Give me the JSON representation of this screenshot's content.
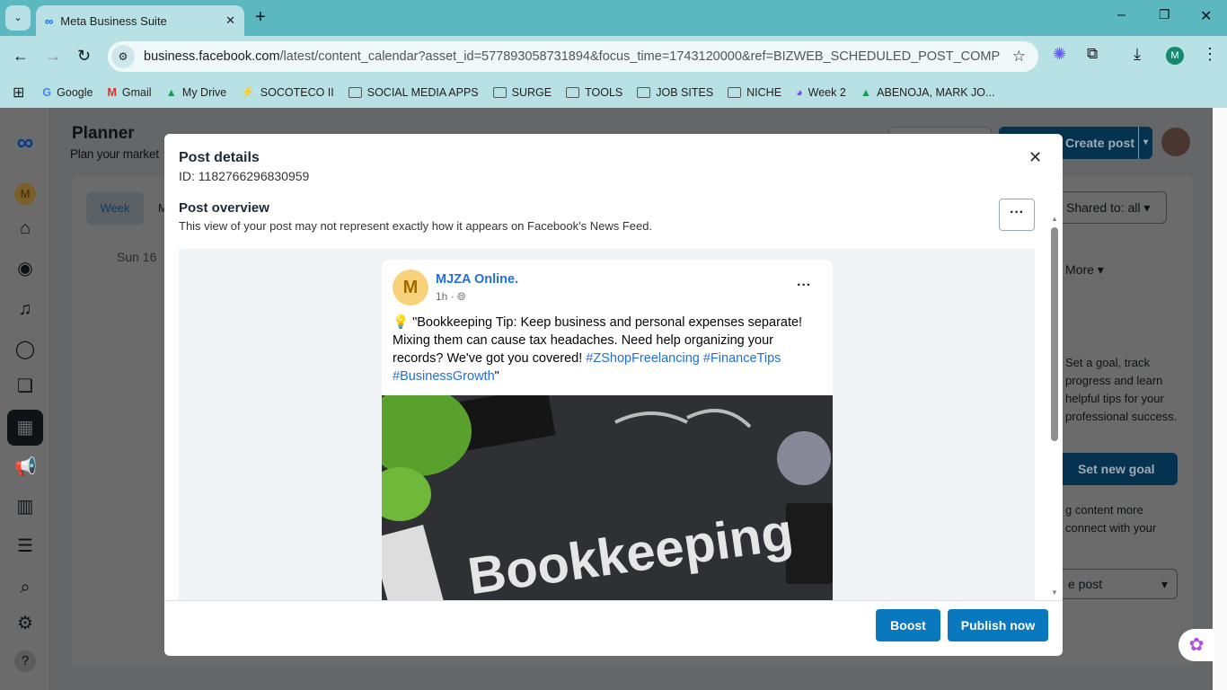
{
  "browser": {
    "tab_title": "Meta Business Suite",
    "url_host": "business.facebook.com",
    "url_path": "/latest/content_calendar?asset_id=577893058731894&focus_time=1743120000&ref=BIZWEB_SCHEDULED_POST_COMPOSER&na...",
    "profile_initial": "M",
    "bookmarks": [
      {
        "label": "Google",
        "icon": "google-icon"
      },
      {
        "label": "Gmail",
        "icon": "gmail-icon"
      },
      {
        "label": "My Drive",
        "icon": "drive-icon"
      },
      {
        "label": "SOCOTECO II",
        "icon": "socoteco-icon"
      },
      {
        "label": "SOCIAL MEDIA APPS",
        "icon": "folder-icon"
      },
      {
        "label": "SURGE",
        "icon": "folder-icon"
      },
      {
        "label": "TOOLS",
        "icon": "folder-icon"
      },
      {
        "label": "JOB SITES",
        "icon": "folder-icon"
      },
      {
        "label": "NICHE",
        "icon": "folder-icon"
      },
      {
        "label": "Week 2",
        "icon": "week-icon"
      },
      {
        "label": "ABENOJA, MARK JO...",
        "icon": "drive-icon"
      }
    ]
  },
  "planner": {
    "title": "Planner",
    "subtitle": "Plan your market",
    "view_week": "Week",
    "view_month": "M",
    "day": "Sun 16",
    "create_post": "Create post",
    "shared_to": "Shared to: all",
    "more": "More",
    "goal_text": "Set a goal, track progress and learn helpful tips for your professional success.",
    "goal_button": "Set new goal",
    "content_text": "g content more",
    "content_text2": "connect with your",
    "create_post_small": "e post"
  },
  "modal": {
    "title": "Post details",
    "id": "ID: 1182766296830959",
    "overview_title": "Post overview",
    "overview_desc": "This view of your post may not represent exactly how it appears on Facebook's News Feed.",
    "boost": "Boost",
    "publish": "Publish now",
    "post": {
      "page_name": "MJZA Online.",
      "avatar_letter": "M",
      "time": "1h",
      "dot": "·",
      "text": "💡 \"Bookkeeping Tip: Keep business and personal expenses separate! Mixing them can cause tax headaches. Need help organizing your records? We've got you covered! ",
      "hashtags": [
        "#ZShopFreelancing",
        "#FinanceTips",
        "#BusinessGrowth"
      ],
      "close_quote": "\"",
      "image_text": "Bookkeeping"
    }
  },
  "colors": {
    "accent": "#0a78be",
    "link": "#216fdb",
    "tabbar": "#5cb8c0",
    "toolbar": "#b8e1e5"
  }
}
